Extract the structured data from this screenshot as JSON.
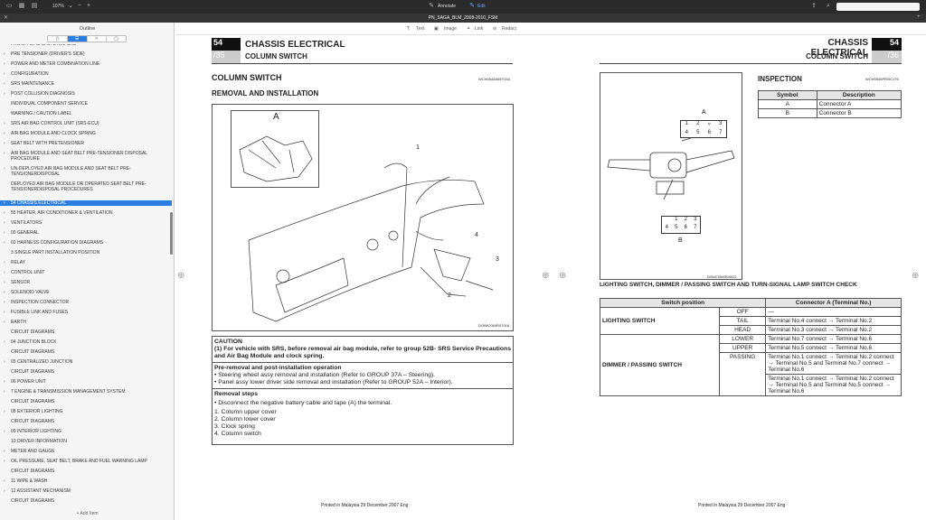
{
  "toolbar": {
    "zoom": "107%",
    "annotate": "Annotate",
    "edit": "Edit"
  },
  "title": "PN_SAGA_BLM_2008-2010_FSM",
  "sidebar": {
    "title": "Outline",
    "add_item": "Add Item",
    "items": [
      {
        "label": "FRONT AIR BAG SYSTEM SRS",
        "chev": false
      },
      {
        "label": "PRE TENSIONER (DRIVER'S SIDE)",
        "chev": true
      },
      {
        "label": "POWER AND METER COMBINATION LINE",
        "chev": true
      },
      {
        "label": "CONFIGURATION",
        "chev": true
      },
      {
        "label": "SRS MAINTENANCE",
        "chev": true
      },
      {
        "label": "POST COLLISION DIAGNOSIS",
        "chev": true
      },
      {
        "label": "INDIVIDUAL COMPONENT SERVICE",
        "chev": false
      },
      {
        "label": "WARNING / CAUTION LABEL",
        "chev": false
      },
      {
        "label": "SRS AIR BAG CONTROL UNIT (SRS-ECU)",
        "chev": true
      },
      {
        "label": "AIR BAG MODULE AND CLOCK SPRING",
        "chev": true
      },
      {
        "label": "SEAT BELT WITH PRETENSIONER",
        "chev": true
      },
      {
        "label": "AIR BAG MODULE AND SEAT BELT PRE-TENSIONER DISPOSAL PROCEDURE",
        "chev": true
      },
      {
        "label": "UN-DEPLOYED AIR BAG MODULE AND SEAT BELT PRE-TENSIONERDISPOSAL",
        "chev": true
      },
      {
        "label": "DEPLOYED AIR BAG MODULE OR OPERATED SEAT BELT PRE-TENSIONERDISPOSAL PROCEDURES",
        "chev": false
      },
      {
        "label": "54 CHASSIS ELECTRICAL",
        "chev": true
      },
      {
        "label": "55 HEATER, AIR CONDITIONER & VENTILATION",
        "chev": true
      },
      {
        "label": "VENTILATORS",
        "chev": true
      },
      {
        "label": "00 GENERAL",
        "chev": true
      },
      {
        "label": "02 HARNESS CONFIGURATION DIAGRAMS",
        "chev": true
      },
      {
        "label": "3 SINGLE PART INSTALLATION POSITION",
        "chev": false
      },
      {
        "label": "RELAY",
        "chev": true
      },
      {
        "label": "CONTROL UNIT",
        "chev": true
      },
      {
        "label": "SENSOR",
        "chev": true
      },
      {
        "label": "SOLENOID VALVE",
        "chev": true
      },
      {
        "label": "INSPECTION CONNECTOR",
        "chev": true
      },
      {
        "label": "FUSIBLE LINK AND FUSES",
        "chev": true
      },
      {
        "label": "EARTH",
        "chev": true
      },
      {
        "label": "CIRCUIT DIAGRAMS",
        "chev": false
      },
      {
        "label": "04 JUNCTION BLOCK",
        "chev": true
      },
      {
        "label": "CIRCUIT DIAGRAMS",
        "chev": false
      },
      {
        "label": "05 CENTRALIZED JUNCTION",
        "chev": true
      },
      {
        "label": "CIRCUIT DIAGRAMS",
        "chev": false
      },
      {
        "label": "06 POWER UNIT",
        "chev": true
      },
      {
        "label": "7 ENGINE & TRANSMISSION MANAGEMENT SYSTEM",
        "chev": true
      },
      {
        "label": "CIRCUIT DIAGRAMS",
        "chev": false
      },
      {
        "label": "08 EXTERIOR LIGHTING",
        "chev": true
      },
      {
        "label": "CIRCUIT DIAGRAMS",
        "chev": false
      },
      {
        "label": "09 INTERIOR LIGHTING",
        "chev": true
      },
      {
        "label": "10 DRIVER INFORMATION",
        "chev": false
      },
      {
        "label": "METER AND GAUGE",
        "chev": true
      },
      {
        "label": "OIL PRESSURE, SEAT BELT, BRAKE AND FUEL WARNING LAMP",
        "chev": true
      },
      {
        "label": "CIRCUIT DIAGRAMS",
        "chev": false
      },
      {
        "label": "11 WIPE & WASH",
        "chev": true
      },
      {
        "label": "12 ASSISTANT MECHANISM",
        "chev": true
      },
      {
        "label": "CIRCUIT DIAGRAMS",
        "chev": false
      }
    ]
  },
  "annot": {
    "text": "Text",
    "image": "Image",
    "link": "Link",
    "redact": "Redact"
  },
  "left_page": {
    "section_no": "54",
    "page_no": "/35",
    "section": "CHASSIS ELECTRICAL",
    "subsection": "COLUMN SWITCH",
    "heading": "COLUMN SWITCH",
    "code": "WCH0545A55Y154",
    "subheading": "REMOVAL AND INSTALLATION",
    "fig_code": "DOIMC054R07018",
    "label_a": "A",
    "callouts": [
      "1",
      "2",
      "3",
      "4"
    ],
    "caution_title": "CAUTION",
    "caution_text": "(1) For vehicle with SRS, before removal air bag module, refer to group 52B- SRS Service Precautions and Air Bag Module and clock spring.",
    "pre_title": "Pre-removal and post-installation operation",
    "pre_items": [
      "• Steering wheel assy removal and installation (Refer to GROUP 37A – Steering).",
      "• Panel assy lower driver side removal and installation (Refer to GROUP 52A – Interior)."
    ],
    "rem_title": "Removal steps",
    "rem_intro": "• Disconnect the negative battery cable and tape (A) the terminal.",
    "rem_steps": [
      "1.   Column upper cover",
      "2.   Column lower cover",
      "3.   Clock spring",
      "4.   Column switch"
    ],
    "footer": "Printed in Malaysia 29 December 2007 Eng"
  },
  "right_page": {
    "section_no": "54",
    "page_no": "/36",
    "section": "CHASSIS ELECTRICAL",
    "subsection": "COLUMN SWITCH",
    "inspection": "INSPECTION",
    "code": "WCH0545PROC176",
    "sym_headers": [
      "Symbol",
      "Description"
    ],
    "sym_rows": [
      [
        "A",
        "Connector A"
      ],
      [
        "B",
        "Connector B"
      ]
    ],
    "fig_code": "DOUC054R04022",
    "conn_a": "A",
    "conn_b": "B",
    "conn_a_pins": [
      "1",
      "2",
      "3",
      "4",
      "5",
      "6",
      "7"
    ],
    "conn_b_pins": [
      "1",
      "2",
      "3",
      "4",
      "5",
      "6",
      "7",
      "8"
    ],
    "check_title": "LIGHTING SWITCH, DIMMER / PASSING SWITCH AND TURN-SIGNAL LAMP SWITCH CHECK",
    "check_headers": [
      "Switch position",
      "Connector A (Terminal No.)"
    ],
    "lighting": "LIGHTING SWITCH",
    "off": "OFF",
    "dash": "—",
    "tail": "TAIL",
    "tail_val": "Terminal No.4 connect → Terminal No.2",
    "head": "HEAD",
    "head_val": "Terminal No.3 connect → Terminal No.2",
    "dimmer": "DIMMER / PASSING SWITCH",
    "lower": "LOWER",
    "lower_val": "Terminal No.7 connect → Terminal No.6",
    "upper": "UPPER",
    "upper_val": "Terminal No.5 connect → Terminal No.6",
    "passing": "PASSING",
    "passing_val1": "Terminal No.1 connect → Terminal No.2 connect → Terminal No.5 and Terminal No.7 connect → Terminal No.6",
    "passing_val2": "Terminal No.1 connect → Terminal No.2 connect → Terminal No.5 and Terminal No.5 connect → Terminal No.6",
    "footer": "Printed in Malaysia 29 December 2007 Eng"
  }
}
